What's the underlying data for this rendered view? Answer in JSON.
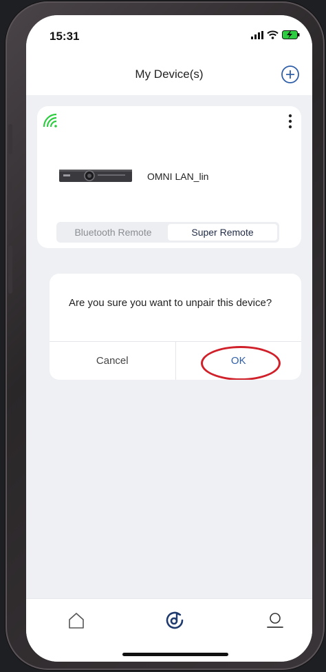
{
  "status_bar": {
    "time": "15:31"
  },
  "header": {
    "title": "My Device(s)",
    "add_icon": "plus-circle-icon"
  },
  "device_card": {
    "status_icon": "wifi-icon",
    "status_color": "#2ecc40",
    "name": "OMNI LAN_lin",
    "remote_tabs": [
      {
        "label": "Bluetooth Remote",
        "selected": false
      },
      {
        "label": "Super Remote",
        "selected": true
      }
    ]
  },
  "dialog": {
    "message": "Are you sure you want to unpair this device?",
    "cancel_label": "Cancel",
    "ok_label": "OK",
    "highlight_color": "#d0202a"
  },
  "tab_bar": {
    "items": [
      {
        "icon": "home-icon"
      },
      {
        "icon": "music-disc-icon"
      },
      {
        "icon": "profile-icon"
      }
    ]
  },
  "colors": {
    "accent": "#2f5fa8",
    "background": "#eef0f3"
  }
}
